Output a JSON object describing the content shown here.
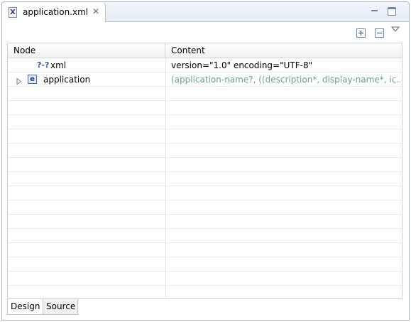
{
  "editor": {
    "tab_title": "application.xml",
    "tab_icon_letter": "X",
    "close_glyph": "✕"
  },
  "table": {
    "headers": {
      "node": "Node",
      "content": "Content"
    },
    "rows": [
      {
        "node": "xml",
        "content": "version=\"1.0\" encoding=\"UTF-8\"",
        "icon": "?-?",
        "icon_name": "processing-instruction-icon"
      },
      {
        "node": "application",
        "content": "(application-name?, ((description*, display-name*, ic...",
        "icon": "e",
        "icon_name": "element-icon",
        "expandable": true
      }
    ]
  },
  "bottom_tabs": {
    "design": "Design",
    "source": "Source"
  },
  "colors": {
    "border": "#a7b3c4",
    "muted_content": "#6aa08e",
    "accent": "#2f58a8"
  }
}
